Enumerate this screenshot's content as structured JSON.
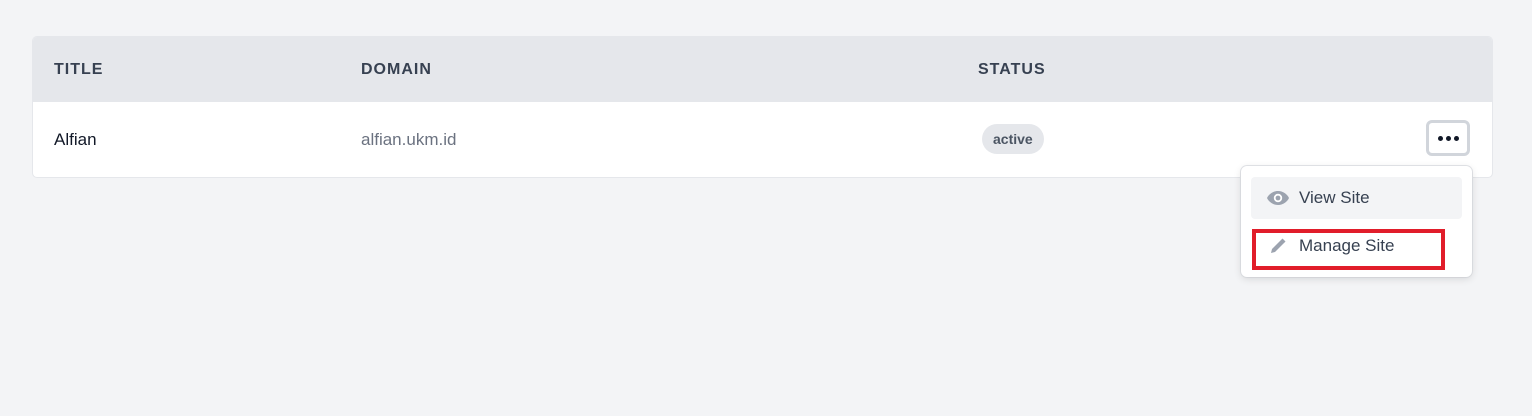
{
  "table": {
    "headers": {
      "title": "TITLE",
      "domain": "DOMAIN",
      "status": "STATUS"
    },
    "rows": [
      {
        "title": "Alfian",
        "domain": "alfian.ukm.id",
        "status": "active"
      }
    ]
  },
  "row_actions": {
    "button_icon": "more-horizontal-icon",
    "menu": [
      {
        "label": "View Site",
        "icon": "eye-icon"
      },
      {
        "label": "Manage Site",
        "icon": "pencil-icon"
      }
    ]
  },
  "colors": {
    "highlight": "#e11d2a",
    "header_bg": "#e5e7eb",
    "page_bg": "#f3f4f6"
  }
}
